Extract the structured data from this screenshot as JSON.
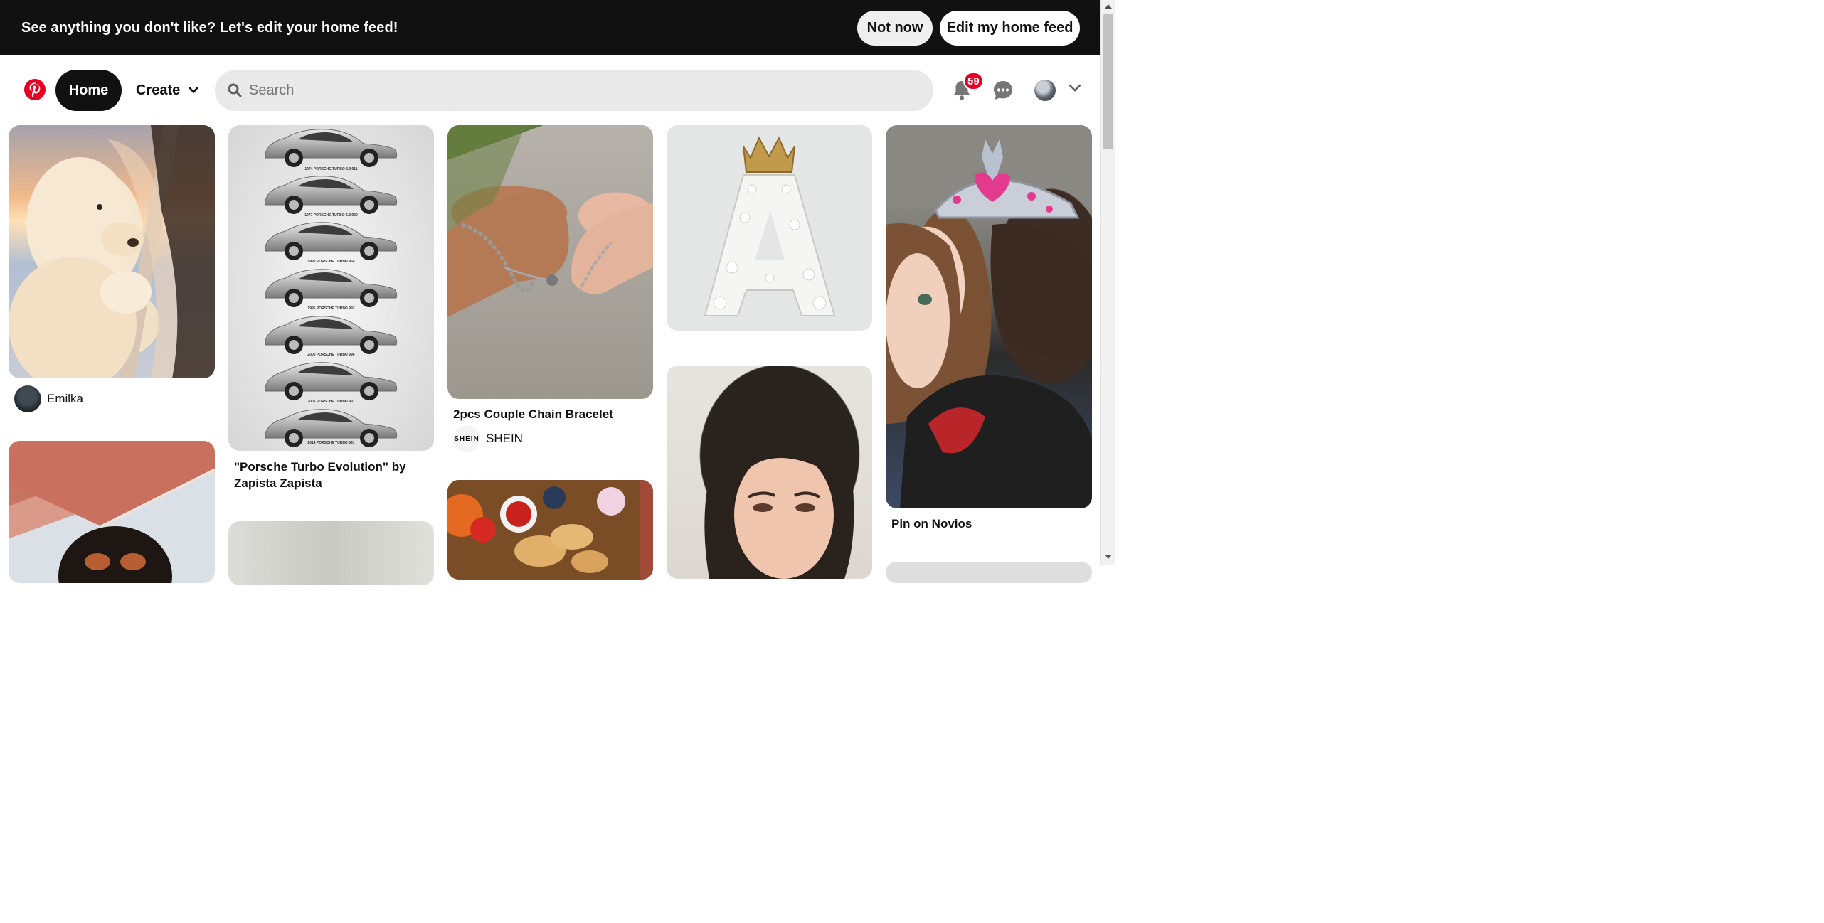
{
  "banner": {
    "text": "See anything you don't like? Let's edit your home feed!",
    "not_now": "Not now",
    "edit": "Edit my home feed"
  },
  "header": {
    "home": "Home",
    "create": "Create",
    "search_placeholder": "Search",
    "notification_count": "59"
  },
  "colors": {
    "brand": "#e60023",
    "banner_bg": "#111111",
    "search_bg": "#e9e9e9"
  },
  "pins": {
    "puppy": {
      "author": "Emilka"
    },
    "porsche": {
      "title": "\"Porsche Turbo Evolution\" by Zapista Zapista",
      "captions": [
        "1974 PORSCHE TURBO 3.0 911",
        "1977 PORSCHE TURBO 3.3 930",
        "1990 PORSCHE TURBO 964",
        "1995 PORSCHE TURBO 993",
        "2000 PORSCHE TURBO 996",
        "2006 PORSCHE TURBO 997",
        "2014 PORSCHE TURBO 991"
      ]
    },
    "bracelet": {
      "title": "2pcs Couple Chain Bracelet",
      "author": "SHEIN",
      "author_logo": "SHEIN"
    },
    "letter": {
      "letter": "A"
    },
    "tiara": {
      "title": "Pin on Novios"
    }
  }
}
